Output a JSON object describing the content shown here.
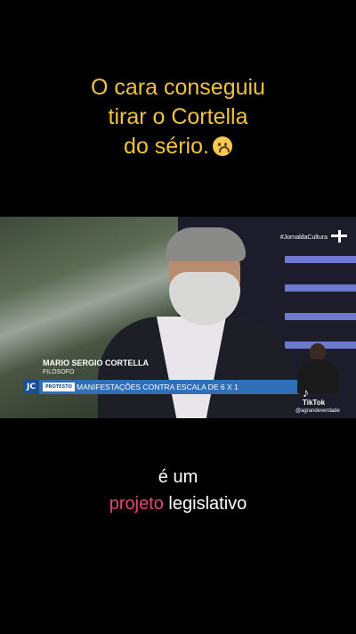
{
  "caption": {
    "line1": "O cara conseguiu",
    "line2": "tirar o Cortella",
    "line3": "do sério.",
    "emoji": "worried-face-icon",
    "color": "#f2c23a"
  },
  "video": {
    "channel_tag": "#JornaldaCultura",
    "lower_third": {
      "name": "MARIO SERGIO CORTELLA",
      "role": "FILÓSOFO",
      "badge": "JC",
      "tag": "PROTESTO",
      "headline": "MANIFESTAÇÕES CONTRA ESCALA DE 6 X 1",
      "color": "#2f6fb7"
    },
    "tiktok": {
      "brand": "TikTok",
      "handle": "@agrandeverdade"
    }
  },
  "subtitle": {
    "line1": "é um",
    "highlight": "projeto",
    "rest": " legislativo",
    "highlight_color": "#e8407a"
  }
}
